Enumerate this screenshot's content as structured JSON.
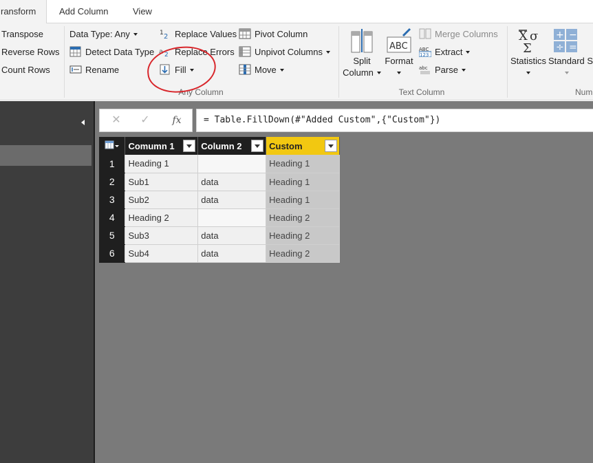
{
  "tabs": [
    {
      "label": "ransform",
      "active": true
    },
    {
      "label": "Add Column",
      "active": false
    },
    {
      "label": "View",
      "active": false
    }
  ],
  "ribbon": {
    "table_group": {
      "transpose": "Transpose",
      "reverse_rows": "Reverse Rows",
      "count_rows": "Count Rows"
    },
    "any_column": {
      "data_type": "Data Type: Any",
      "detect_data_type": "Detect Data Type",
      "rename": "Rename",
      "replace_values": "Replace Values",
      "replace_errors": "Replace Errors",
      "fill": "Fill",
      "pivot_column": "Pivot Column",
      "unpivot_columns": "Unpivot Columns",
      "move": "Move",
      "label": "Any Column"
    },
    "text_column": {
      "split_column_l1": "Split",
      "split_column_l2": "Column",
      "format": "Format",
      "merge_columns": "Merge Columns",
      "extract": "Extract",
      "parse": "Parse",
      "label": "Text Column"
    },
    "number_column": {
      "statistics": "Statistics",
      "standard": "Standard S",
      "label": "Num"
    }
  },
  "formula_bar": {
    "cancel_glyph": "✕",
    "confirm_glyph": "✓",
    "fx_glyph": "fx",
    "formula": "= Table.FillDown(#\"Added Custom\",{\"Custom\"})"
  },
  "grid": {
    "columns": [
      "Comumn 1",
      "Column 2",
      "Custom"
    ],
    "rows": [
      {
        "n": "1",
        "c1": "Heading 1",
        "c2": "",
        "c3": "Heading 1"
      },
      {
        "n": "2",
        "c1": "Sub1",
        "c2": "data",
        "c3": "Heading 1"
      },
      {
        "n": "3",
        "c1": "Sub2",
        "c2": "data",
        "c3": "Heading 1"
      },
      {
        "n": "4",
        "c1": "Heading 2",
        "c2": "",
        "c3": "Heading 2"
      },
      {
        "n": "5",
        "c1": "Sub3",
        "c2": "data",
        "c3": "Heading 2"
      },
      {
        "n": "6",
        "c1": "Sub4",
        "c2": "data",
        "c3": "Heading 2"
      }
    ]
  },
  "colors": {
    "annotation": "#d8262b",
    "custom_header": "#f2c811",
    "accent_blue": "#2b6cb0"
  }
}
